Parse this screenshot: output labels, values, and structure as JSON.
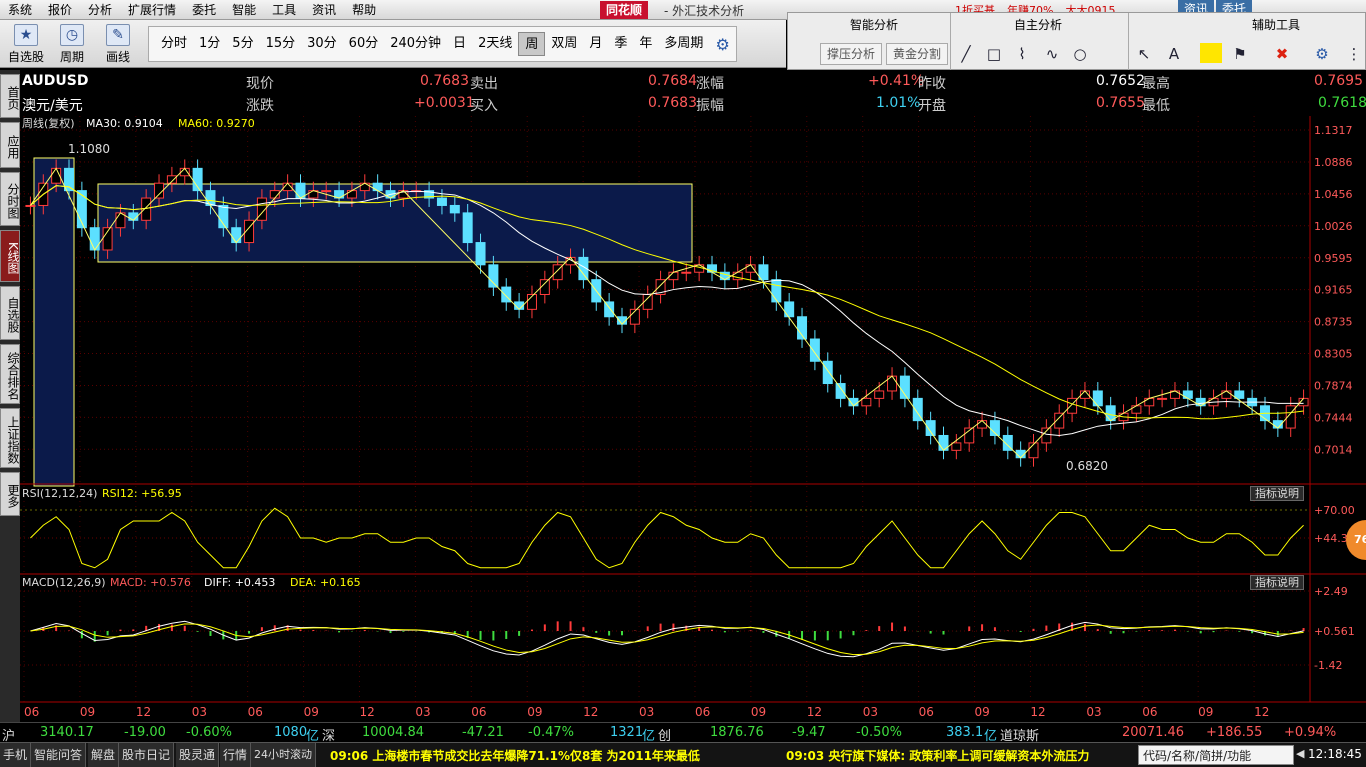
{
  "menu": [
    "系统",
    "报价",
    "分析",
    "扩展行情",
    "委托",
    "智能",
    "工具",
    "资讯",
    "帮助"
  ],
  "brand": "同花顺",
  "subtitle": "- 外汇技术分析",
  "topright": {
    "ad1": "1折买基",
    "ad2": "年赚70%",
    "ad3": "大大0915"
  },
  "winbtns": {
    "info": "资讯",
    "trade": "委托"
  },
  "toolbar": {
    "zixuan_label": "自选股",
    "zhouqi_label": "周期",
    "huaxian_label": "画线"
  },
  "periods": [
    "分时",
    "1分",
    "5分",
    "15分",
    "30分",
    "60分",
    "240分钟",
    "日",
    "2天线",
    "周",
    "双周",
    "月",
    "季",
    "年",
    "多周期"
  ],
  "active_period": "周",
  "panel": {
    "smart": "智能分析",
    "self": "自主分析",
    "aux": "辅助工具",
    "btn1": "撑压分析",
    "btn2": "黄金分割"
  },
  "sidetabs": [
    "首页",
    "应用",
    "分时图",
    "K线图",
    "自选股",
    "综合排名",
    "上证指数",
    "更多"
  ],
  "quote": {
    "code": "AUDUSD",
    "name": "澳元/美元",
    "xianjia_l": "现价",
    "xianjia": "0.7683",
    "maichu_l": "卖出",
    "maichu": "0.7684",
    "zhangfu_l": "涨幅",
    "zhangfu": "+0.41%",
    "zuoshou_l": "昨收",
    "zuoshou": "0.7652",
    "zuigao_l": "最高",
    "zuigao": "0.7695",
    "zhangdie_l": "涨跌",
    "zhangdie": "+0.0031",
    "mairu_l": "买入",
    "mairu": "0.7683",
    "zhenfu_l": "振幅",
    "zhenfu": "1.01%",
    "kaipan_l": "开盘",
    "kaipan": "0.7655",
    "zuidi_l": "最低",
    "zuidi": "0.7618"
  },
  "ma_legend": {
    "label": "周线(复权)",
    "ma30": "MA30: 0.9104",
    "ma60": "MA60: 0.9270"
  },
  "price_ticks": [
    "1.1317",
    "1.0886",
    "1.0456",
    "1.0026",
    "0.9595",
    "0.9165",
    "0.8735",
    "0.8305",
    "0.7874",
    "0.7444",
    "0.7014"
  ],
  "annot_high": "1.1080",
  "annot_low": "0.6820",
  "rsi": {
    "legend": "RSI(12,12,24)",
    "value": "RSI12: +56.95",
    "btn": "指标说明",
    "ticks": [
      "+70.00",
      "+44.37"
    ]
  },
  "macd": {
    "legend": "MACD(12,26,9)",
    "macd": "MACD: +0.576",
    "diff": "DIFF: +0.453",
    "dea": "DEA: +0.165",
    "btn": "指标说明",
    "ticks": [
      "+2.49",
      "+0.561",
      "-1.42"
    ]
  },
  "x_ticks": [
    "06",
    "09",
    "12",
    "03",
    "06",
    "09",
    "12",
    "03",
    "06",
    "09",
    "12",
    "03",
    "06",
    "09",
    "12",
    "03",
    "06",
    "09",
    "12",
    "03",
    "06",
    "09",
    "12"
  ],
  "status": {
    "sh": "沪",
    "sh_val": "3140.17",
    "sh_chg": "-19.00",
    "sh_pct": "-0.60%",
    "sh_amt": "1080",
    "yi": "亿",
    "sz": "深",
    "sz_val": "10004.84",
    "sz_chg": "-47.21",
    "sz_pct": "-0.47%",
    "sz_amt": "1321",
    "chuang": "创",
    "cy_val": "1876.76",
    "cy_chg": "-9.47",
    "cy_pct": "-0.50%",
    "cy_amt": "383.1",
    "dj": "道琼斯",
    "dj_val": "20071.46",
    "dj_chg": "+186.55",
    "dj_pct": "+0.94%"
  },
  "bottom": {
    "b1": "手机",
    "b2": "智能问答",
    "b3": "解盘",
    "b4": "股市日记",
    "b5": "股灵通",
    "b6": "行情",
    "b7": "24小时滚动",
    "news1": "09:06 上海楼市春节成交比去年爆降71.1%仅8套 为2011年来最低",
    "news2": "09:03 央行旗下媒体: 政策利率上调可缓解资本外流压力",
    "search": "代码/名称/简拼/功能",
    "time": "12:18:45"
  },
  "bubble": "76",
  "chart_data": {
    "type": "candlestick",
    "symbol": "AUDUSD",
    "period": "weekly",
    "ylim": [
      0.682,
      1.1317
    ],
    "high": 1.108,
    "low": 0.682,
    "close": [
      1.03,
      1.06,
      1.08,
      1.05,
      1.0,
      0.97,
      1.0,
      1.02,
      1.01,
      1.04,
      1.06,
      1.07,
      1.08,
      1.05,
      1.03,
      1.0,
      0.98,
      1.01,
      1.04,
      1.05,
      1.06,
      1.04,
      1.05,
      1.05,
      1.04,
      1.05,
      1.06,
      1.05,
      1.04,
      1.05,
      1.05,
      1.04,
      1.03,
      1.02,
      0.98,
      0.95,
      0.92,
      0.9,
      0.89,
      0.91,
      0.93,
      0.95,
      0.96,
      0.93,
      0.9,
      0.88,
      0.87,
      0.89,
      0.91,
      0.93,
      0.94,
      0.94,
      0.95,
      0.94,
      0.93,
      0.94,
      0.95,
      0.93,
      0.9,
      0.88,
      0.85,
      0.82,
      0.79,
      0.77,
      0.76,
      0.77,
      0.78,
      0.8,
      0.77,
      0.74,
      0.72,
      0.7,
      0.71,
      0.73,
      0.74,
      0.72,
      0.7,
      0.69,
      0.71,
      0.73,
      0.75,
      0.77,
      0.78,
      0.76,
      0.74,
      0.75,
      0.76,
      0.77,
      0.77,
      0.78,
      0.77,
      0.76,
      0.77,
      0.78,
      0.77,
      0.76,
      0.74,
      0.73,
      0.76,
      0.77
    ],
    "ma30": 0.9104,
    "ma60": 0.927,
    "rsi12": 56.95,
    "macd": 0.576,
    "diff": 0.453,
    "dea": 0.165
  }
}
